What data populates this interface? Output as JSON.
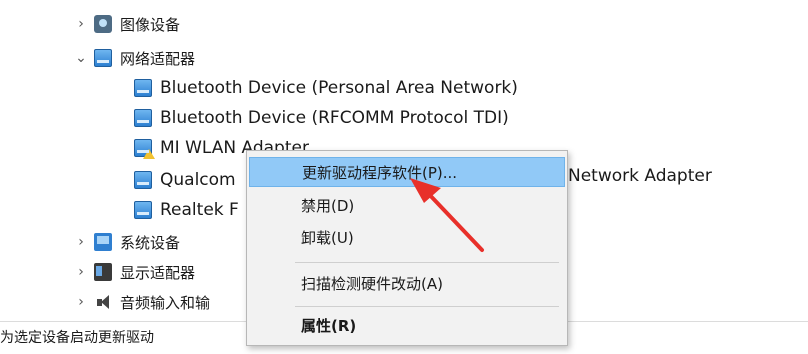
{
  "tree": {
    "image_devices": "图像设备",
    "network_adapters": "网络适配器",
    "adapters": [
      "Bluetooth Device (Personal Area Network)",
      "Bluetooth Device (RFCOMM Protocol TDI)",
      "MI WLAN Adapter",
      "Qualcom",
      "Realtek F"
    ],
    "qualcomm_tail": "Network Adapter",
    "system_devices": "系统设备",
    "display_adapters": "显示适配器",
    "audio": "音频输入和输"
  },
  "context_menu": {
    "update_driver": "更新驱动程序软件(P)...",
    "disable": "禁用(D)",
    "uninstall": "卸载(U)",
    "scan": "扫描检测硬件改动(A)",
    "properties": "属性(R)"
  },
  "status_bar": {
    "text": "为选定设备启动更新驱动"
  },
  "colors": {
    "highlight": "#91c9f7",
    "arrow": "#e8302a"
  }
}
